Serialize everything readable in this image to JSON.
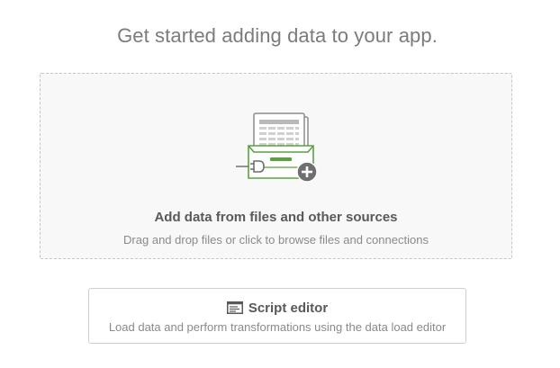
{
  "headline": "Get started adding data to your app.",
  "add_data": {
    "title": "Add data from files and other sources",
    "subtitle": "Drag and drop files or click to browse files and connections",
    "icon": "add-data-illustration-icon"
  },
  "script_editor": {
    "title": "Script editor",
    "description": "Load data and perform transformations using the data load editor",
    "icon": "script-editor-icon"
  },
  "colors": {
    "accent_green": "#5aa23d",
    "text_dark": "#595959",
    "text_light": "#8a8a8a",
    "headline": "#7b7b7b",
    "dropzone_border": "#c6c6c6",
    "dropzone_bg": "#f8f8f8"
  }
}
